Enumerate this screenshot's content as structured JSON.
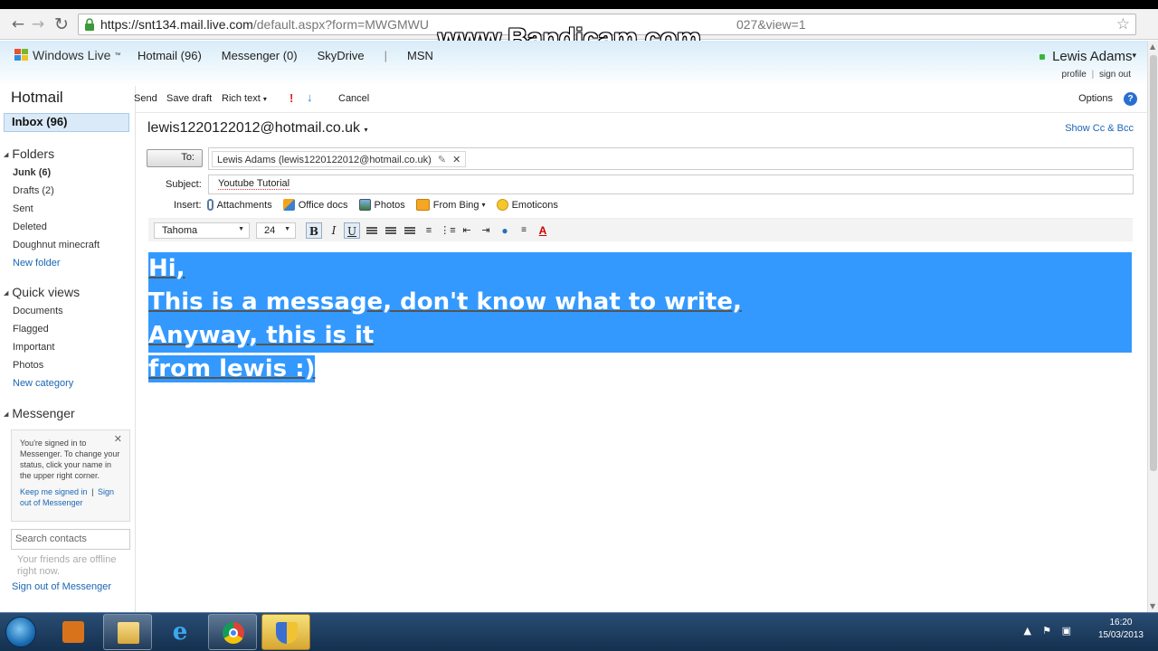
{
  "browser": {
    "url_host": "https://snt134.mail.live.com",
    "url_rest": "/default.aspx?form=MWGMWU",
    "url_tail": "027&view=1",
    "watermark": "www.Bandicam.com"
  },
  "header": {
    "brand": "Windows Live",
    "brand_tm": "™",
    "nav": [
      "Hotmail (96)",
      "Messenger (0)",
      "SkyDrive",
      "|",
      "MSN"
    ],
    "user": "Lewis Adams",
    "user_caret": "▾",
    "profile": "profile",
    "separator": "|",
    "signout": "sign out"
  },
  "sidebar": {
    "title": "Hotmail",
    "inbox": "Inbox (96)",
    "folders_head": "Folders",
    "folders": [
      "Junk (6)",
      "Drafts (2)",
      "Sent",
      "Deleted",
      "Doughnut minecraft"
    ],
    "new_folder": "New folder",
    "quickviews_head": "Quick views",
    "quickviews": [
      "Documents",
      "Flagged",
      "Important",
      "Photos"
    ],
    "new_category": "New category",
    "messenger_head": "Messenger",
    "messenger_note": "You're signed in to Messenger. To change your status, click your name in the upper right corner.",
    "keep_signed": "Keep me signed in",
    "sign_out_of": "Sign out of Messenger",
    "close": "✕",
    "search_placeholder": "Search contacts",
    "offline": "Your friends are offline right now.",
    "signout_messenger": "Sign out of Messenger"
  },
  "toolbar": {
    "send": "Send",
    "save_draft": "Save draft",
    "rich_text": "Rich text",
    "caret": "▾",
    "cancel": "Cancel",
    "options": "Options",
    "help": "?"
  },
  "compose": {
    "from": "lewis1220122012@hotmail.co.uk",
    "from_caret": "▾",
    "show_cc": "Show Cc & Bcc",
    "to_label": "To:",
    "recipient": "Lewis Adams  (lewis1220122012@hotmail.co.uk)",
    "recipient_remove": "✕",
    "subject_label": "Subject:",
    "subject": "Youtube Tutorial",
    "insert_label": "Insert:",
    "insert_items": [
      "Attachments",
      "Office docs",
      "Photos",
      "From Bing",
      "Emoticons"
    ],
    "font": "Tahoma",
    "size": "24",
    "body_lines": [
      "Hi,",
      "This is a message, don't know what to write,",
      "Anyway, this is it",
      "from lewis :)"
    ]
  },
  "taskbar": {
    "time": "16:20",
    "date": "15/03/2013"
  },
  "colors": {
    "selection": "#3399ff",
    "link": "#1a66b5",
    "status_online": "#3bb53b"
  }
}
